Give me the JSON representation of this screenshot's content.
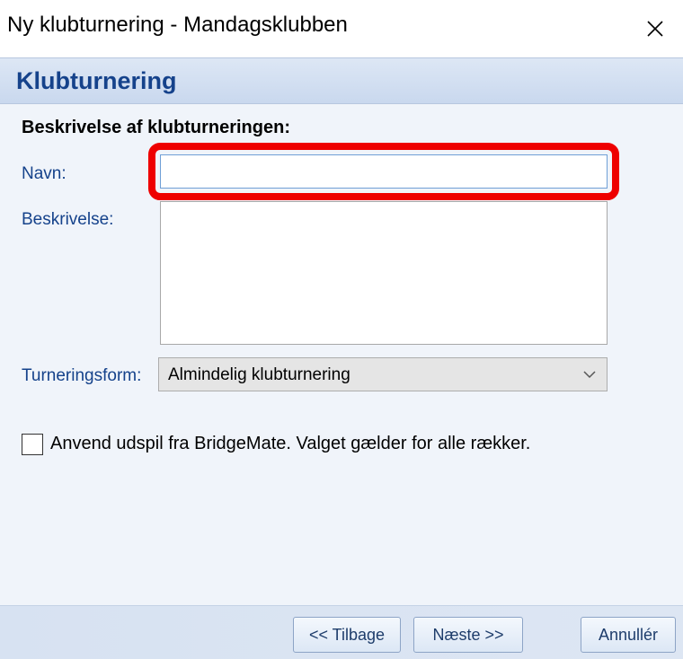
{
  "window": {
    "title": "Ny klubturnering - Mandagsklubben",
    "close_icon": "close-icon"
  },
  "header": {
    "title": "Klubturnering"
  },
  "form": {
    "section_heading": "Beskrivelse af klubturneringen:",
    "name_label": "Navn:",
    "name_value": "",
    "description_label": "Beskrivelse:",
    "description_value": "",
    "tournament_form_label": "Turneringsform:",
    "tournament_form_value": "Almindelig klubturnering",
    "checkbox_label": "Anvend udspil fra BridgeMate. Valget gælder for alle rækker.",
    "checkbox_checked": false
  },
  "footer": {
    "back_label": "<< Tilbage",
    "next_label": "Næste >>",
    "cancel_label": "Annullér"
  },
  "colors": {
    "accent_title": "#15428b",
    "highlight": "#ee0000",
    "header_band": "#d3e0f2"
  }
}
